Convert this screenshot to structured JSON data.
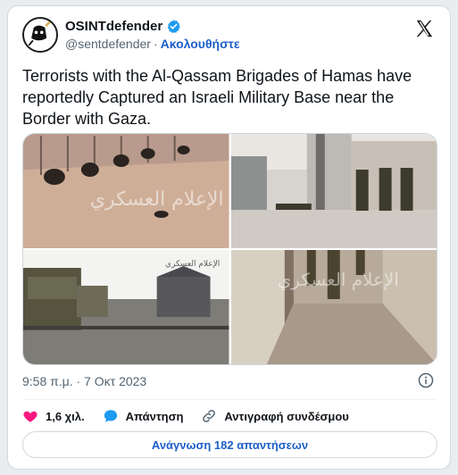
{
  "account": {
    "display_name": "OSINTdefender",
    "handle": "@sentdefender",
    "separator": "·",
    "follow_label": "Ακολουθήστε",
    "verified_color": "#1d9bf0"
  },
  "tweet": {
    "text": "Terrorists with the Al-Qassam Brigades of Hamas have reportedly Captured an Israeli Military Base near the Border with Gaza.",
    "timestamp": "9:58 π.μ. · 7 Οκτ 2023",
    "watermark_text": "الإعلام العسكري"
  },
  "actions": {
    "likes_count": "1,6 χιλ.",
    "reply_label": "Απάντηση",
    "copy_link_label": "Αντιγραφή συνδέσμου",
    "read_replies_label": "Ανάγνωση 182 απαντήσεων"
  },
  "colors": {
    "like": "#f91880",
    "accent": "#1d9bf0",
    "link": "#1d5ec9"
  },
  "icons": {
    "x_logo": "x-logo-icon",
    "verified": "verified-badge-icon",
    "info": "info-icon",
    "like": "heart-icon",
    "reply": "speech-bubble-icon",
    "copy_link": "link-icon"
  }
}
